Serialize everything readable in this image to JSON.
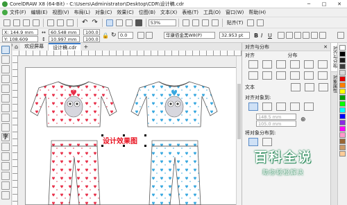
{
  "window": {
    "title": "CorelDRAW X8 (64-Bit) - C:\\Users\\Administrator\\Desktop\\CDR\\设计稿.cdr",
    "controls": {
      "minimize": "─",
      "maximize": "□",
      "close": "✕"
    }
  },
  "menu": [
    "文件(F)",
    "编辑(E)",
    "视图(V)",
    "布局(L)",
    "对象(C)",
    "效果(C)",
    "位图(B)",
    "文本(X)",
    "表格(T)",
    "工具(O)",
    "窗口(W)",
    "帮助(H)"
  ],
  "toolbar": {
    "zoom": "53%",
    "snap_label": "贴齐(T)"
  },
  "propbar": {
    "x": "X: 144.9 mm",
    "y": "Y: 108.609 mm",
    "w": "60.548 mm",
    "h": "10.997 mm",
    "scale_w": "100.0",
    "scale_h": "100.0",
    "angle": "0.0",
    "font": "华康佰金黑W8(P)",
    "size": "32.953 pt",
    "bold": "B",
    "italic": "I",
    "underline": "U"
  },
  "tabs": [
    "欢迎屏幕",
    "设计稿.cdr"
  ],
  "canvas": {
    "label": "设计效果图",
    "pattern": "heart-print pajama set"
  },
  "docker": {
    "title": "对齐与分布",
    "section_align": "对齐",
    "section_distribute": "分布",
    "section_text": "文本",
    "align_to": "对齐对象到:",
    "x_value": "148.5 mm",
    "y_value": "105.0 mm",
    "distribute_to": "将对象分布到:",
    "side_tabs": [
      "对齐与分布",
      "对象属性"
    ]
  },
  "watermark": {
    "title": "百科全说",
    "subtitle": "助你轻松解决"
  },
  "colors": {
    "red": "#e8304a",
    "blue": "#38a8e0",
    "accent": "#0f7ac8",
    "brand_green": "#2a8a5a"
  },
  "palette": [
    "#ffffff",
    "#000000",
    "#1a1a1a",
    "#3c3c3c",
    "#d8d8d8",
    "#e00000",
    "#ff7f00",
    "#ffff00",
    "#00a000",
    "#00ff00",
    "#00ffff",
    "#0000ff",
    "#8a2be2",
    "#ff00ff",
    "#ff99cc",
    "#996633",
    "#cc9966",
    "#ffcc99"
  ]
}
